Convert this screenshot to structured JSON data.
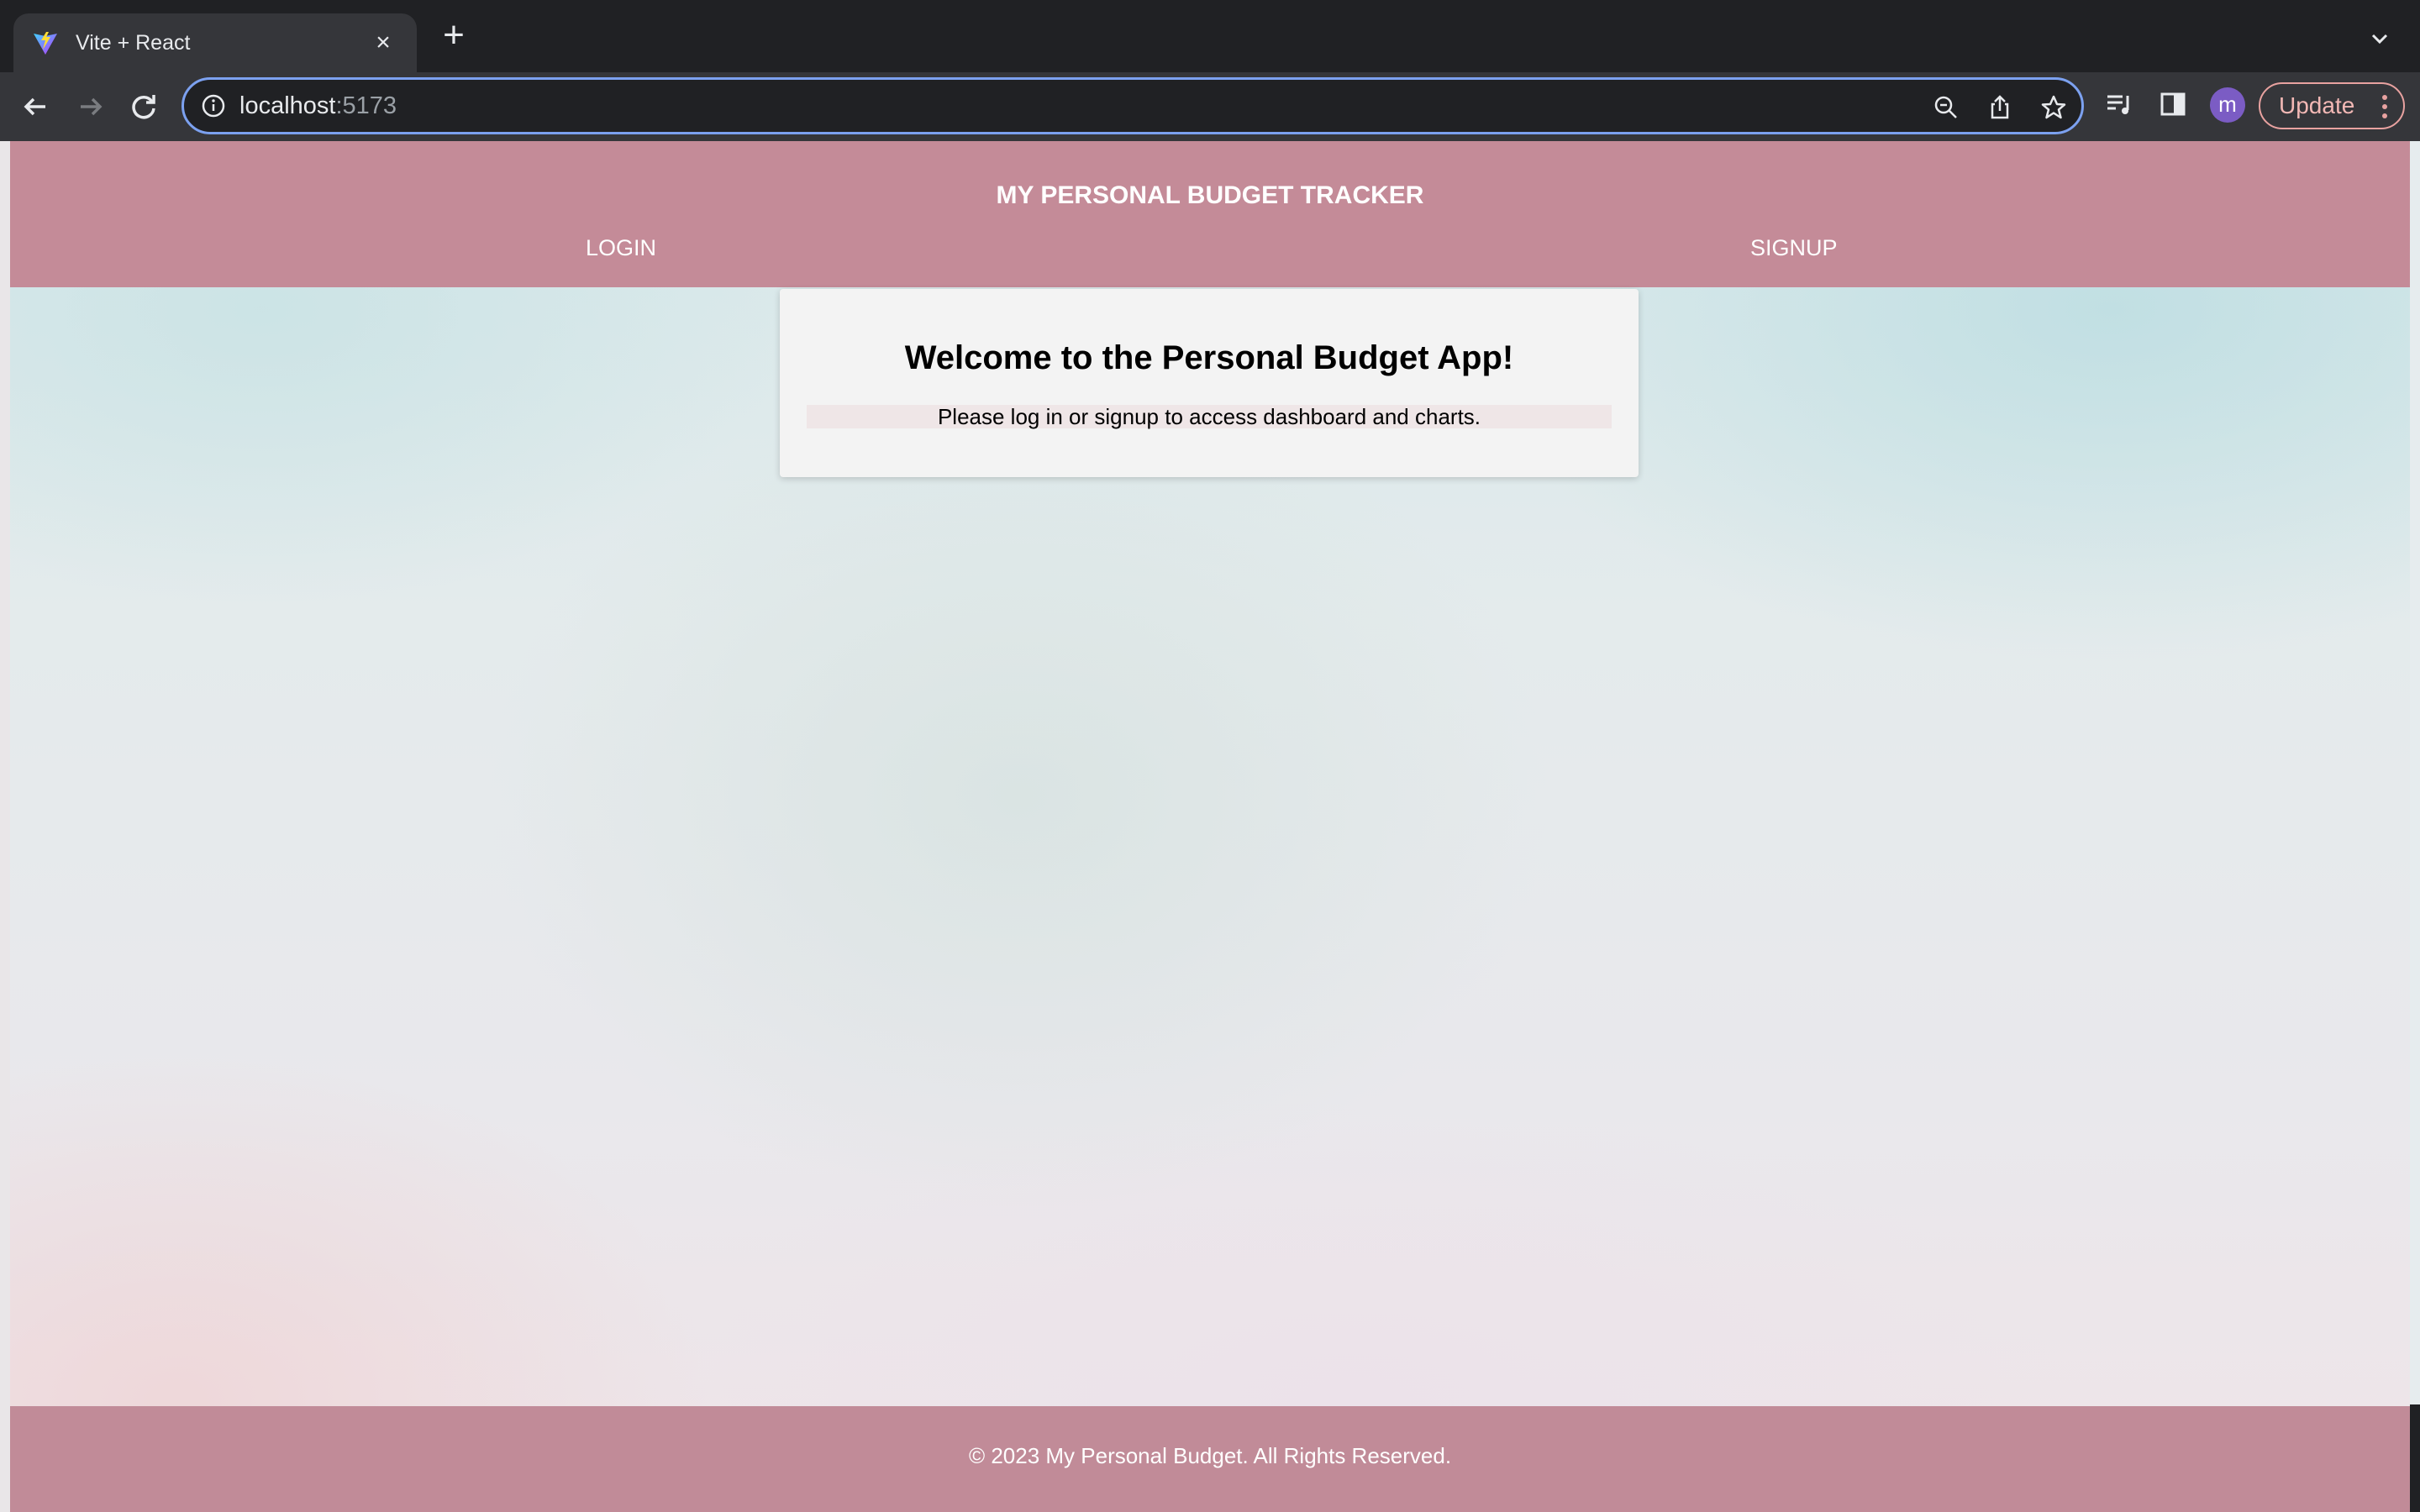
{
  "browser": {
    "tab_title": "Vite + React",
    "url_host": "localhost",
    "url_port": ":5173",
    "profile_initial": "m",
    "update_label": "Update"
  },
  "app": {
    "title": "MY PERSONAL BUDGET TRACKER",
    "nav": {
      "login": "LOGIN",
      "signup": "SIGNUP"
    },
    "welcome": {
      "heading": "Welcome to the Personal Budget App!",
      "message": "Please log in or signup to access dashboard and charts."
    },
    "footer": "© 2023 My Personal Budget. All Rights Reserved.",
    "colors": {
      "header_bg": "#c48b98",
      "footer_bg": "#c18b98",
      "card_bg": "#f3f3f3"
    }
  }
}
